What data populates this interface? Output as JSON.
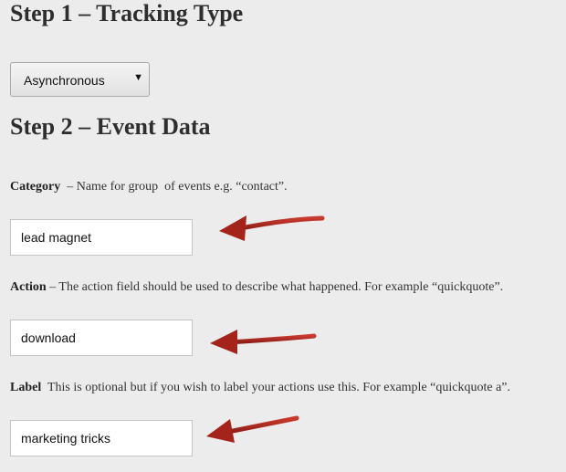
{
  "step1": {
    "title": "Step 1 – Tracking Type",
    "tracking_type_select": {
      "selected": "Asynchronous",
      "caret": "▼"
    }
  },
  "step2": {
    "title": "Step 2 – Event Data",
    "category": {
      "label": "Category",
      "description": "  – Name for group  of events e.g. “contact”.",
      "value": "lead magnet"
    },
    "action": {
      "label": "Action",
      "description": " – The action field should be used to describe what happened. For example “quickquote”.",
      "value": "download"
    },
    "label": {
      "label": "Label",
      "description": "  This is optional but if you wish to label your actions use this. For example “quickquote a”.",
      "value": "marketing tricks"
    }
  },
  "annotations": {
    "arrow_color": "#b3261e",
    "arrow_icon": "red-arrow-annotation"
  }
}
